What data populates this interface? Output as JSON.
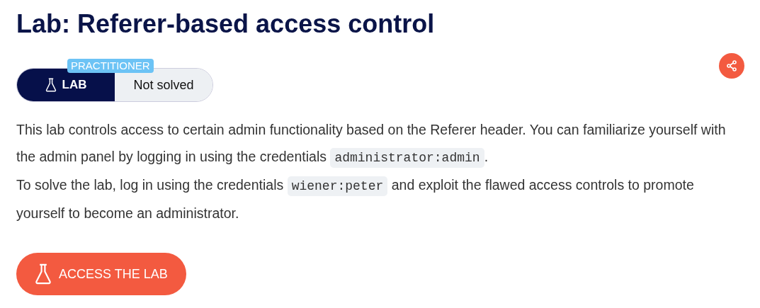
{
  "title": "Lab: Referer-based access control",
  "badge": {
    "level": "PRACTITIONER",
    "type": "LAB",
    "status": "Not solved"
  },
  "paragraphs": [
    [
      {
        "kind": "text",
        "text": "This lab controls access to certain admin functionality based on the Referer header. You can familiarize yourself with the admin panel by logging in using the credentials "
      },
      {
        "kind": "code",
        "text": "administrator:admin"
      },
      {
        "kind": "text",
        "text": "."
      }
    ],
    [
      {
        "kind": "text",
        "text": "To solve the lab, log in using the credentials "
      },
      {
        "kind": "code",
        "text": "wiener:peter"
      },
      {
        "kind": "text",
        "text": " and exploit the flawed access controls to promote yourself to become an administrator."
      }
    ]
  ],
  "button": "ACCESS THE LAB"
}
